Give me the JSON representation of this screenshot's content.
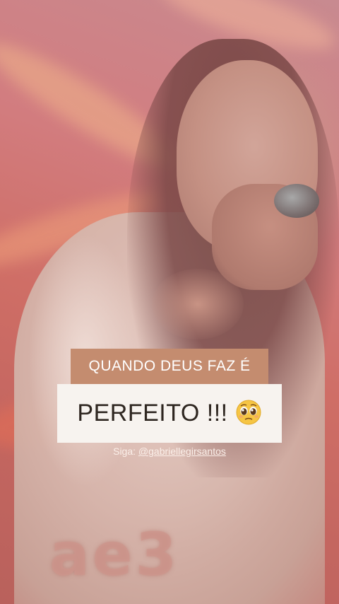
{
  "overlay": {
    "caption_line1": "QUANDO DEUS FAZ É",
    "caption_line2": "PERFEITO !!!",
    "caption_emoji": "pleading-face-icon",
    "follow_prefix": "Siga:",
    "follow_handle": "@gabriellegirsantos",
    "watermark": "ae3"
  },
  "colors": {
    "caption_top_bg": "#c48c6f",
    "caption_main_bg": "#f7f3ef",
    "caption_main_text": "#2e2620"
  }
}
